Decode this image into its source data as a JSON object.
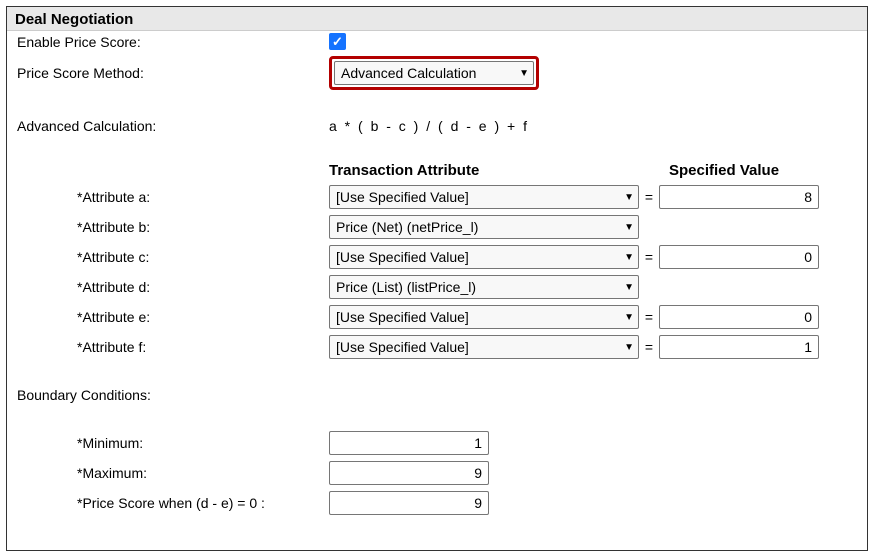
{
  "panel": {
    "title": "Deal Negotiation"
  },
  "labels": {
    "enablePriceScore": "Enable Price Score:",
    "priceScoreMethod": "Price Score Method:",
    "advancedCalc": "Advanced Calculation:",
    "formula": "a * ( b - c ) / ( d - e ) + f",
    "transactionAttribute": "Transaction Attribute",
    "specifiedValue": "Specified Value",
    "boundaryConditions": "Boundary Conditions:",
    "eq": "="
  },
  "method": {
    "value": "Advanced Calculation"
  },
  "attributes": [
    {
      "label": "*Attribute a:",
      "attr": "[Use Specified Value]",
      "value": "8"
    },
    {
      "label": "*Attribute b:",
      "attr": "Price (Net) (netPrice_l)",
      "value": null
    },
    {
      "label": "*Attribute c:",
      "attr": "[Use Specified Value]",
      "value": "0"
    },
    {
      "label": "*Attribute d:",
      "attr": "Price (List) (listPrice_l)",
      "value": null
    },
    {
      "label": "*Attribute e:",
      "attr": "[Use Specified Value]",
      "value": "0"
    },
    {
      "label": "*Attribute f:",
      "attr": "[Use Specified Value]",
      "value": "1"
    }
  ],
  "boundary": {
    "min": {
      "label": "*Minimum:",
      "value": "1"
    },
    "max": {
      "label": "*Maximum:",
      "value": "9"
    },
    "zero": {
      "label": "*Price Score when (d - e) = 0 :",
      "value": "9"
    }
  }
}
